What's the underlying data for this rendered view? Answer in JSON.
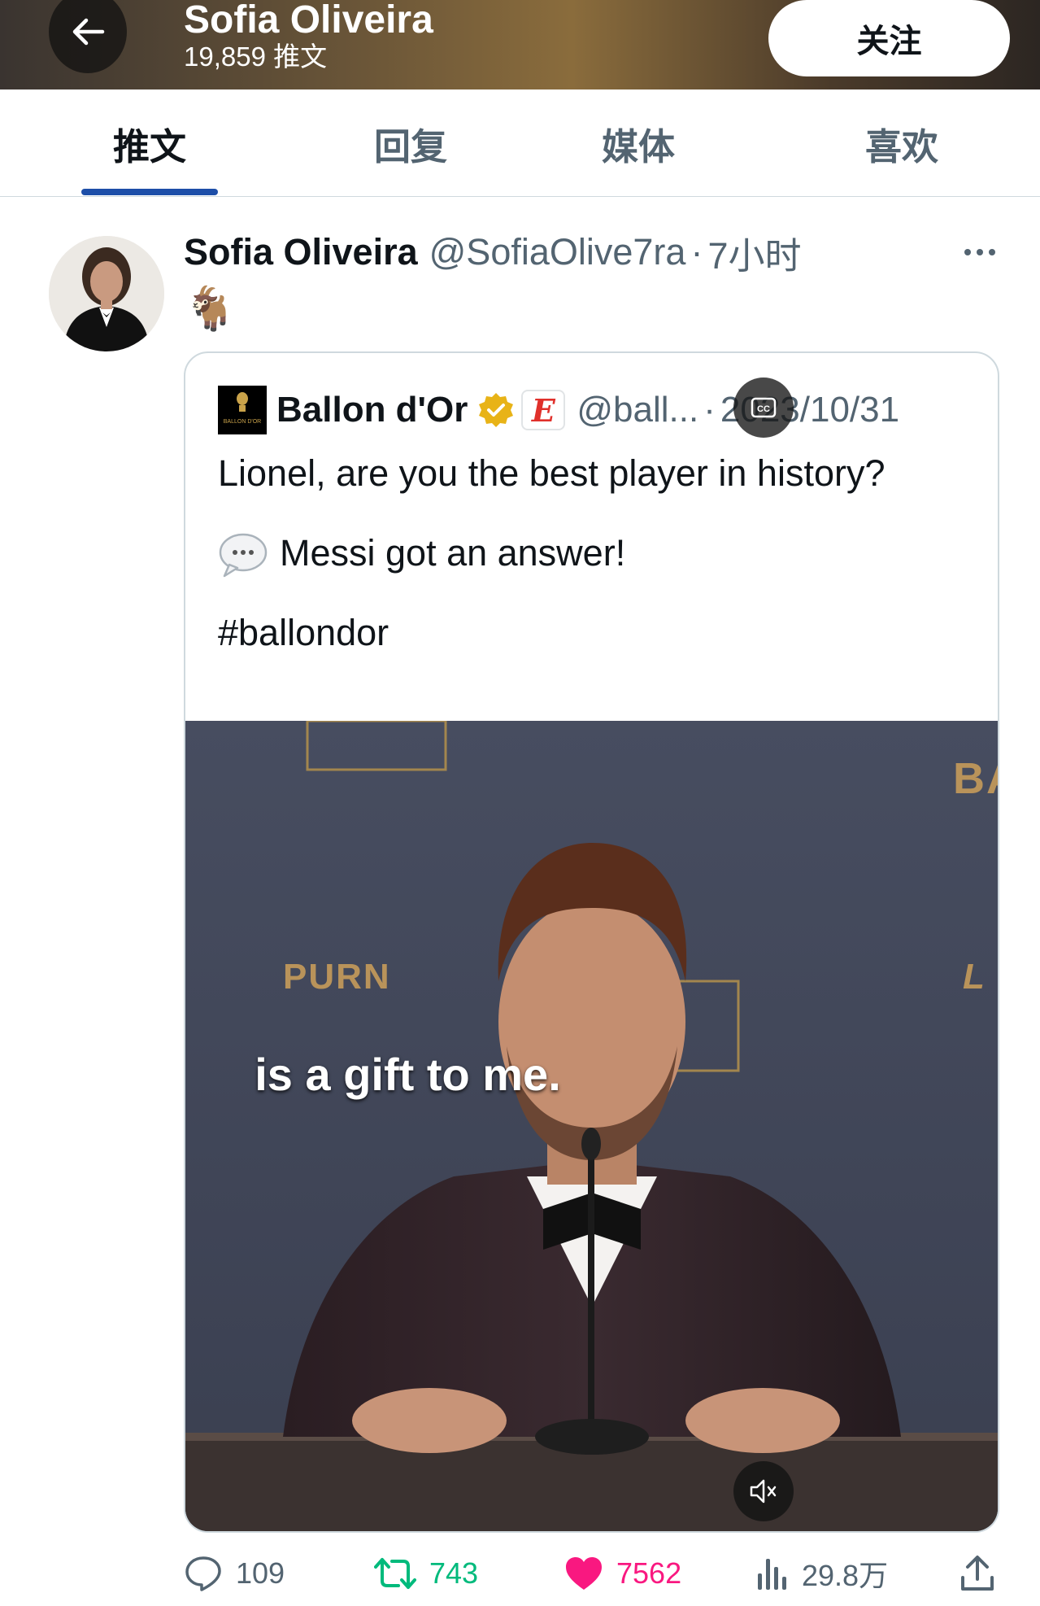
{
  "header": {
    "title": "Sofia Oliveira",
    "post_count": "19,859 推文",
    "follow_label": "关注"
  },
  "tabs": [
    {
      "label": "推文",
      "active": true
    },
    {
      "label": "回复",
      "active": false
    },
    {
      "label": "媒体",
      "active": false
    },
    {
      "label": "喜欢",
      "active": false
    }
  ],
  "tweet": {
    "name": "Sofia Oliveira",
    "handle": "@SofiaOlive7ra",
    "dot": "·",
    "time": "7小时",
    "body_emoji": "🐐",
    "quote": {
      "logo_text": "BALLON D'OR",
      "name": "Ballon d'Or",
      "badge_letter": "E",
      "handle": "@ball...",
      "dot": "·",
      "date": "2023/10/31",
      "line1": "Lionel, are you the best player in history?",
      "line2": "Messi got an answer!",
      "line3": "#ballondor",
      "video": {
        "caption": "is a gift to me.",
        "backdrop_text_left": "PURN",
        "backdrop_text_right": "BA",
        "backdrop_text_right2": "L"
      }
    },
    "actions": {
      "replies": "109",
      "retweets": "743",
      "likes": "7562",
      "views": "29.8万"
    }
  },
  "colors": {
    "accent_underline": "#1d4ea8",
    "retweet": "#00ba7c",
    "like": "#f91880",
    "verified": "#e8b317"
  }
}
